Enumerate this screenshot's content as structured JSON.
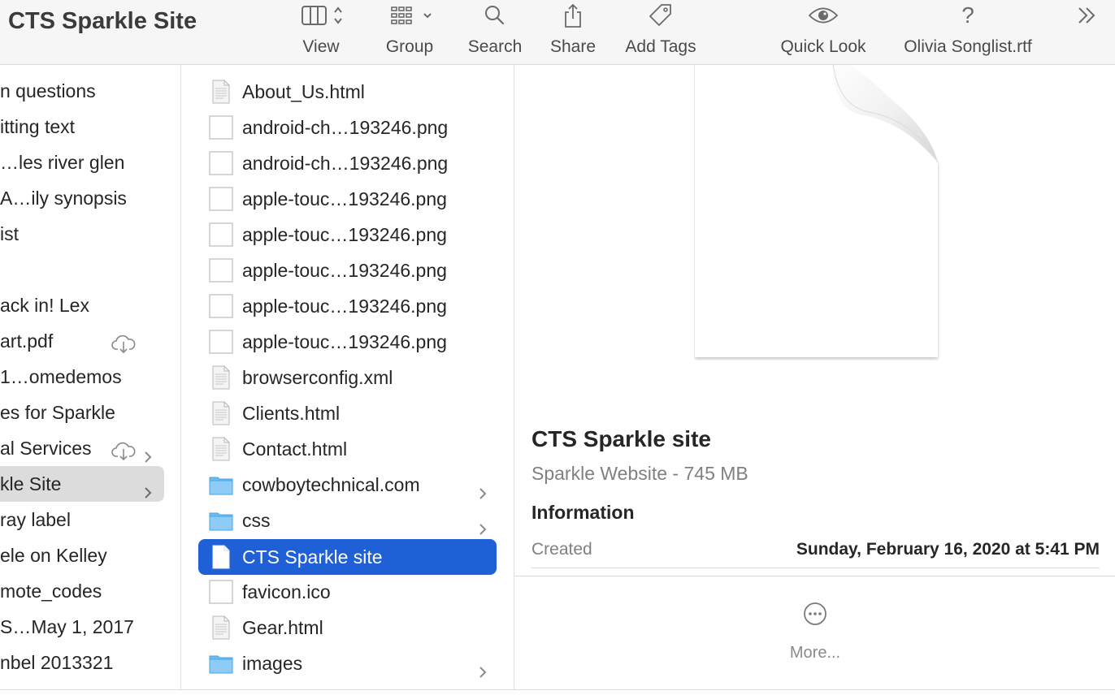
{
  "window": {
    "title": "CTS Sparkle Site"
  },
  "toolbar": {
    "items": [
      {
        "label": "View",
        "icon": "column-view-icon"
      },
      {
        "label": "Group",
        "icon": "group-grid-icon"
      },
      {
        "label": "Search",
        "icon": "search-icon"
      },
      {
        "label": "Share",
        "icon": "share-icon"
      },
      {
        "label": "Add Tags",
        "icon": "tag-icon"
      },
      {
        "label": "Quick Look",
        "icon": "eye-icon"
      },
      {
        "label": "Olivia Songlist.rtf",
        "icon": "question-icon"
      }
    ],
    "overflow_icon": "chevrons-right-icon"
  },
  "column1": {
    "items": [
      {
        "label": "n questions"
      },
      {
        "label": "itting text"
      },
      {
        "label": "…les river glen"
      },
      {
        "label": "A…ily synopsis"
      },
      {
        "label": "ist"
      },
      {
        "label": ""
      },
      {
        "label": "ack in! Lex"
      },
      {
        "label": "art.pdf"
      },
      {
        "label": "1…omedemos"
      },
      {
        "label": "es for Sparkle"
      },
      {
        "label": "al Services"
      },
      {
        "label": "kle Site"
      },
      {
        "label": "ray label"
      },
      {
        "label": "ele on Kelley"
      },
      {
        "label": "mote_codes"
      },
      {
        "label": "S…May 1, 2017"
      },
      {
        "label": "nbel 2013321"
      }
    ]
  },
  "column2": {
    "items": [
      {
        "label": "About_Us.html",
        "kind": "doc"
      },
      {
        "label": "android-ch…193246.png",
        "kind": "image"
      },
      {
        "label": "android-ch…193246.png",
        "kind": "image"
      },
      {
        "label": "apple-touc…193246.png",
        "kind": "image"
      },
      {
        "label": "apple-touc…193246.png",
        "kind": "image"
      },
      {
        "label": "apple-touc…193246.png",
        "kind": "image"
      },
      {
        "label": "apple-touc…193246.png",
        "kind": "image"
      },
      {
        "label": "apple-touc…193246.png",
        "kind": "image"
      },
      {
        "label": "browserconfig.xml",
        "kind": "doc"
      },
      {
        "label": "Clients.html",
        "kind": "doc"
      },
      {
        "label": "Contact.html",
        "kind": "doc"
      },
      {
        "label": "cowboytechnical.com",
        "kind": "folder"
      },
      {
        "label": "css",
        "kind": "folder"
      },
      {
        "label": "CTS Sparkle site",
        "kind": "blank"
      },
      {
        "label": "favicon.ico",
        "kind": "image"
      },
      {
        "label": "Gear.html",
        "kind": "doc"
      },
      {
        "label": "images",
        "kind": "folder"
      }
    ]
  },
  "preview": {
    "title": "CTS Sparkle site",
    "subtitle": "Sparkle Website - 745 MB",
    "info_heading": "Information",
    "created_label": "Created",
    "created_value": "Sunday, February 16, 2020 at 5:41 PM",
    "more_label": "More..."
  },
  "colors": {
    "selection_blue": "#2060d6",
    "folder_blue": "#5db4f0",
    "toolbar_bg": "#f6f6f6"
  }
}
